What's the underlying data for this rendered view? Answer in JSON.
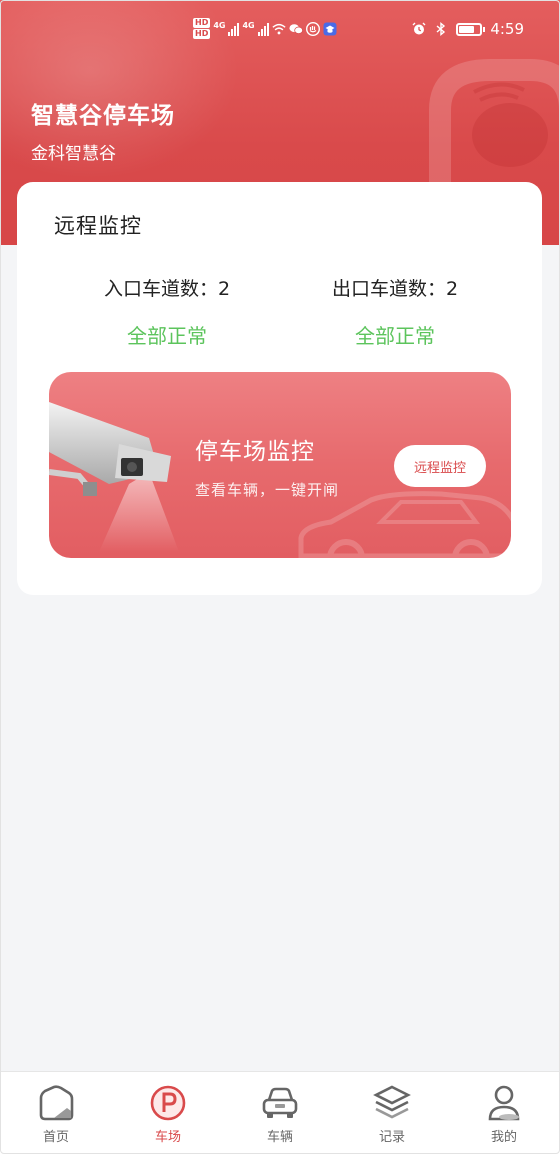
{
  "status_bar": {
    "time": "4:59",
    "signal_labels": [
      "HD",
      "HD"
    ],
    "network": [
      "4G",
      "4G"
    ],
    "icons": [
      "signal-icon",
      "wifi-icon",
      "wechat-icon",
      "app-icon",
      "education-app-icon",
      "alarm-icon",
      "bluetooth-icon",
      "battery-icon"
    ]
  },
  "header": {
    "title": "智慧谷停车场",
    "subtitle": "金科智慧谷",
    "logo_icon": "parking-logo-icon"
  },
  "monitor_card": {
    "title": "远程监控",
    "entry_label": "入口车道数：",
    "entry_count": "2",
    "exit_label": "出口车道数：",
    "exit_count": "2",
    "entry_status": "全部正常",
    "exit_status": "全部正常",
    "status_color": "#5cc45c"
  },
  "banner": {
    "title": "停车场监控",
    "subtitle": "查看车辆，一键开闸",
    "button_label": "远程监控",
    "icon": "security-camera-icon"
  },
  "tabbar": {
    "items": [
      {
        "label": "首页",
        "icon": "home-icon",
        "active": false
      },
      {
        "label": "车场",
        "icon": "parking-icon",
        "active": true
      },
      {
        "label": "车辆",
        "icon": "car-icon",
        "active": false
      },
      {
        "label": "记录",
        "icon": "layers-icon",
        "active": false
      },
      {
        "label": "我的",
        "icon": "profile-icon",
        "active": false
      }
    ]
  },
  "colors": {
    "brand": "#d94a4b",
    "background": "#f4f5f7",
    "success": "#5cc45c"
  }
}
